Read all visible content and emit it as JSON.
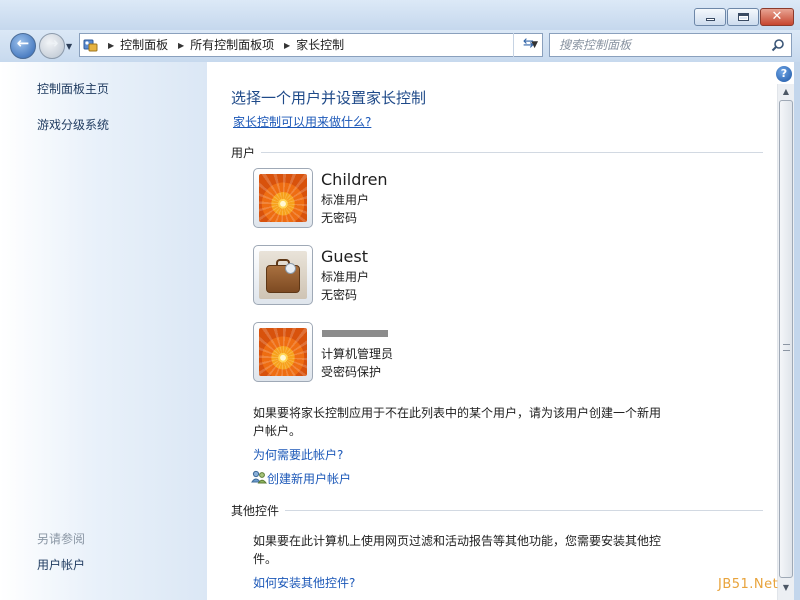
{
  "address": {
    "crumbs": [
      "控制面板",
      "所有控制面板项",
      "家长控制"
    ]
  },
  "search": {
    "placeholder": "搜索控制面板"
  },
  "sidebar": {
    "links": [
      "控制面板主页",
      "游戏分级系统"
    ],
    "see_also_heading": "另请参阅",
    "see_also_links": [
      "用户帐户"
    ]
  },
  "main": {
    "title": "选择一个用户并设置家长控制",
    "what_link": "家长控制可以用来做什么?",
    "users_section": "用户",
    "users": [
      {
        "name": "Children",
        "type": "标准用户",
        "password": "无密码",
        "avatar": "orange-flower"
      },
      {
        "name": "Guest",
        "type": "标准用户",
        "password": "无密码",
        "avatar": "suitcase"
      },
      {
        "name": "",
        "type": "计算机管理员",
        "password": "受密码保护",
        "avatar": "orange-flower"
      }
    ],
    "add_user_note": "如果要将家长控制应用于不在此列表中的某个用户，请为该用户创建一个新用户帐户。",
    "why_account_link": "为何需要此帐户?",
    "create_account_link": "创建新用户帐户",
    "other_controls_section": "其他控件",
    "other_controls_note": "如果要在此计算机上使用网页过滤和活动报告等其他功能，您需要安装其他控件。",
    "install_controls_link": "如何安装其他控件?"
  },
  "watermark": "JB51.Net",
  "colors": {
    "link": "#1c58b8",
    "title": "#1f4a89",
    "accent_orange": "#ee6d12"
  }
}
